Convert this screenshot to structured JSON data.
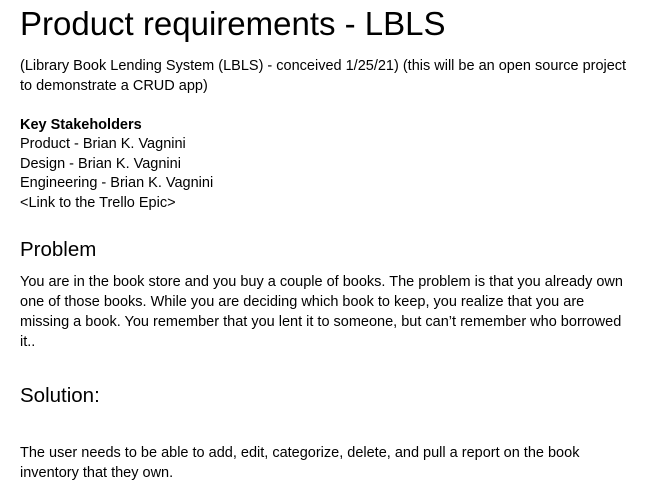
{
  "document": {
    "title": "Product requirements - LBLS",
    "intro": "(Library Book Lending System (LBLS) - conceived 1/25/21) (this will be an open source project to demonstrate a CRUD app)",
    "stakeholders": {
      "heading": "Key Stakeholders",
      "items": [
        "Product - Brian K. Vagnini",
        "Design - Brian K. Vagnini",
        "Engineering - Brian K. Vagnini",
        "<Link to the Trello Epic>"
      ]
    },
    "problem": {
      "heading": "Problem",
      "text": "You are in the book store and you buy a couple of books. The problem is that you already own one of those books.  While you are deciding which book to keep, you realize that you are missing a book. You remember that you lent it to someone, but can’t remember who borrowed it.."
    },
    "solution": {
      "heading": "Solution:",
      "text": "The user needs to be able to add, edit, categorize, delete, and pull a report on the book inventory that they own."
    }
  }
}
